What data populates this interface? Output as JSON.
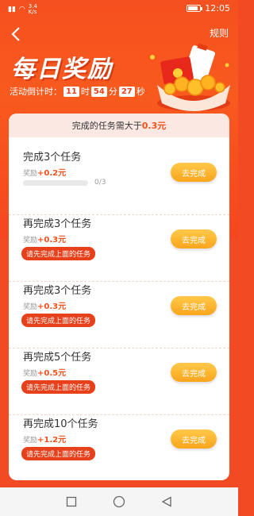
{
  "status_bar": {
    "network": "3.4\nK/s",
    "battery": "",
    "time": "12:05"
  },
  "header": {
    "rules_label": "规则",
    "title": "每日奖励",
    "countdown_label": "活动倒计时：",
    "hours": "11",
    "hours_unit": "时",
    "minutes": "54",
    "minutes_unit": "分",
    "seconds": "27",
    "seconds_unit": "秒"
  },
  "notice": {
    "prefix": "完成的任务需大于",
    "amount": "0.3元"
  },
  "tasks": [
    {
      "title": "完成3个任务",
      "reward_label": "奖励",
      "reward": "+0.2元",
      "progress_text": "0/3",
      "progress": 0,
      "button": "去完成"
    },
    {
      "title": "再完成3个任务",
      "reward_label": "奖励",
      "reward": "+0.3元",
      "lock": "请先完成上面的任务",
      "button": "去完成"
    },
    {
      "title": "再完成3个任务",
      "reward_label": "奖励",
      "reward": "+0.3元",
      "lock": "请先完成上面的任务",
      "button": "去完成"
    },
    {
      "title": "再完成5个任务",
      "reward_label": "奖励",
      "reward": "+0.5元",
      "lock": "请先完成上面的任务",
      "button": "去完成"
    },
    {
      "title": "再完成10个任务",
      "reward_label": "奖励",
      "reward": "+1.2元",
      "lock": "请先完成上面的任务",
      "button": "去完成"
    }
  ],
  "colors": {
    "brand": "#f24a22",
    "accent": "#f2511b",
    "button": "#f9a51c"
  }
}
